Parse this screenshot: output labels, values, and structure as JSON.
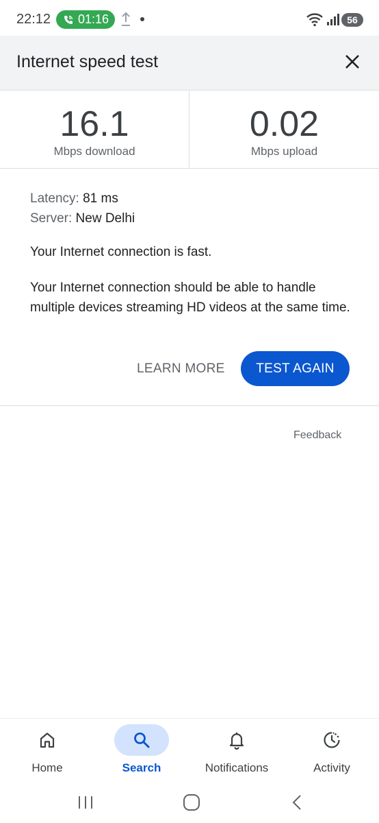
{
  "status_bar": {
    "time": "22:12",
    "call_duration": "01:16",
    "battery": "56"
  },
  "header": {
    "title": "Internet speed test",
    "close_icon": "close-icon"
  },
  "results": {
    "download": {
      "value": "16.1",
      "unit": "Mbps download"
    },
    "upload": {
      "value": "0.02",
      "unit": "Mbps upload"
    }
  },
  "details": {
    "latency_label": "Latency:",
    "latency_value": "81 ms",
    "server_label": "Server:",
    "server_value": "New Delhi",
    "summary": "Your Internet connection is fast.",
    "description": "Your Internet connection should be able to handle multiple devices streaming HD videos at the same time."
  },
  "actions": {
    "learn_more": "LEARN MORE",
    "test_again": "TEST AGAIN"
  },
  "feedback": "Feedback",
  "bottom_nav": {
    "items": [
      {
        "label": "Home",
        "icon": "home-icon"
      },
      {
        "label": "Search",
        "icon": "search-icon",
        "active": true
      },
      {
        "label": "Notifications",
        "icon": "bell-icon"
      },
      {
        "label": "Activity",
        "icon": "activity-icon"
      }
    ]
  },
  "colors": {
    "accent": "#0b57d0",
    "accent_light": "#d3e3fd",
    "call_green": "#34a853",
    "header_bg": "#f1f3f4"
  }
}
